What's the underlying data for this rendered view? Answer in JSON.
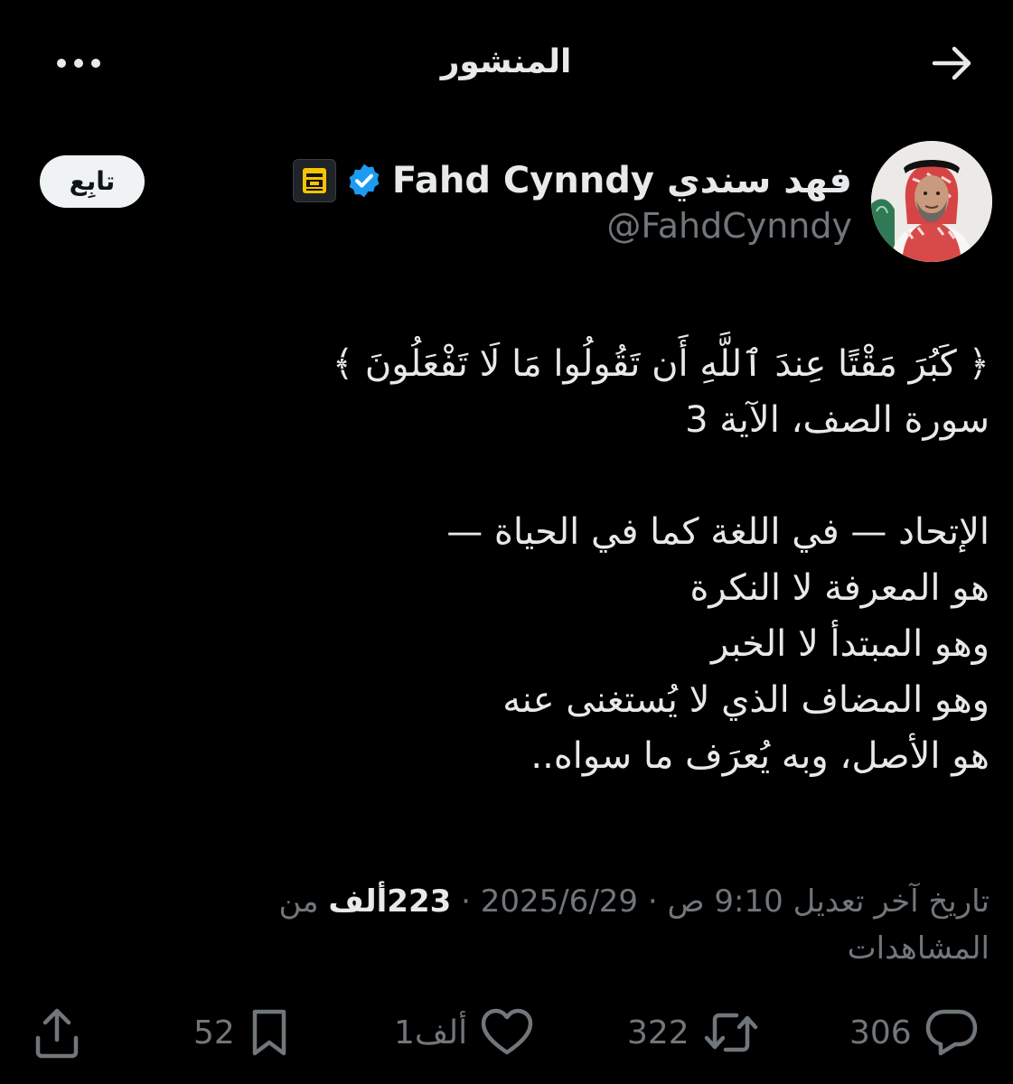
{
  "header": {
    "title": "المنشور",
    "more_icon": "more-horizontal-icon",
    "back_icon": "arrow-right-icon"
  },
  "author": {
    "display_name": "فهد سندي Fahd Cynndy",
    "handle": "@FahdCynndy",
    "verified_color": "#1d9bf0",
    "follow_label": "تابِع"
  },
  "post": {
    "lines": [
      "﴿ كَبُرَ مَقْتًا عِندَ ٱللَّهِ أَن تَقُولُوا مَا لَا تَفْعَلُونَ ﴾",
      "سورة الصف، الآية 3",
      "",
      "الإتحاد — في اللغة كما في الحياة —",
      "هو المعرفة لا النكرة",
      "وهو المبتدأ لا الخبر",
      "وهو المضاف الذي لا يُستغنى عنه",
      "هو الأصل، وبه يُعرَف ما سواه.."
    ]
  },
  "meta": {
    "edited_label": "تاريخ آخر تعديل",
    "time": "9:10 ص",
    "separator": "·",
    "date": "2025/6/29",
    "views_count": "223ألف",
    "views_label": "من المشاهدات"
  },
  "actions": {
    "replies": "306",
    "reposts": "322",
    "likes": "1ألف",
    "bookmarks": "52"
  },
  "colors": {
    "background": "#000000",
    "text_primary": "#e7e9ea",
    "text_secondary": "#71767b",
    "follow_button_bg": "#eff3f4"
  }
}
